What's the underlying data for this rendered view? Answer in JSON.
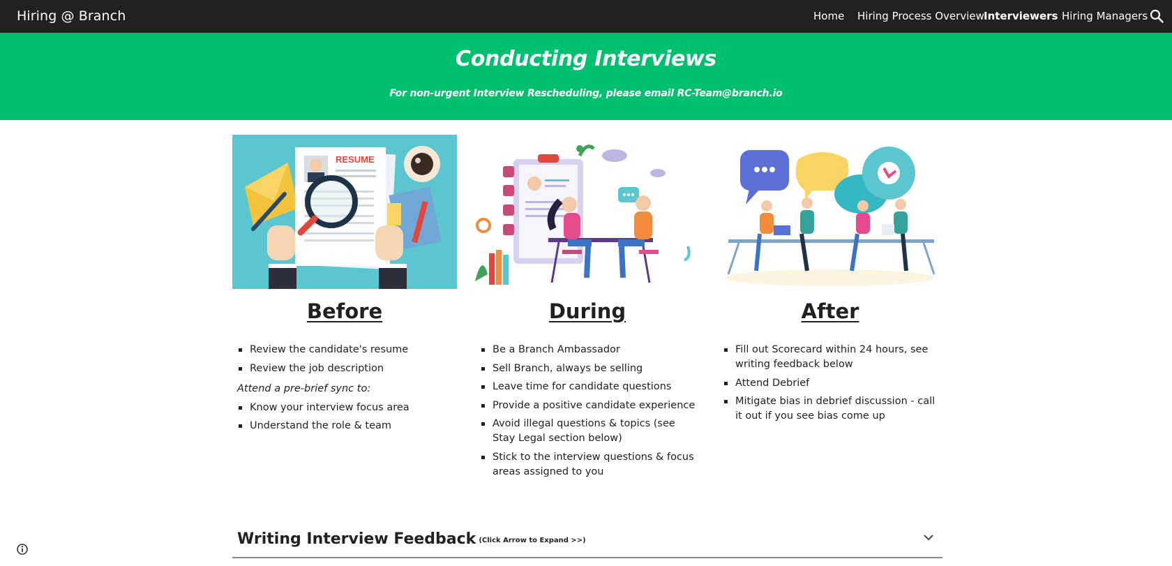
{
  "site": {
    "title": "Hiring @ Branch"
  },
  "nav": {
    "items": [
      {
        "label": "Home"
      },
      {
        "label": "Hiring Process Overview"
      },
      {
        "label": "Interviewers"
      },
      {
        "label": "Hiring Managers"
      }
    ],
    "active": "Interviewers",
    "search_icon": "search-icon"
  },
  "hero": {
    "title": "Conducting Interviews",
    "subtitle": "For non-urgent Interview Rescheduling, please email RC-Team@branch.io",
    "background": "#00bf6f"
  },
  "columns": [
    {
      "heading": "Before",
      "image": "resume-review-illustration",
      "items": [
        "Review the candidate's resume",
        "Review the job description"
      ],
      "note": "Attend a pre-brief sync to:",
      "items2": [
        "Know your interview focus area",
        "Understand the role & team"
      ]
    },
    {
      "heading": "During",
      "image": "interview-conversation-illustration",
      "items": [
        "Be a Branch Ambassador",
        "Sell Branch, always be selling",
        "Leave time for candidate questions",
        "Provide a positive candidate experience",
        "Avoid illegal questions & topics (see Stay Legal section below)",
        "Stick to the interview questions & focus areas assigned to you"
      ]
    },
    {
      "heading": "After",
      "image": "team-debrief-illustration",
      "items": [
        "Fill out Scorecard within 24 hours, see writing feedback below",
        "Attend Debrief",
        "Mitigate bias in debrief discussion - call it out if you see bias come up"
      ]
    }
  ],
  "section": {
    "title": "Writing Interview Feedback",
    "hint": "(Click Arrow to Expand >>)",
    "icon": "chevron-down-icon"
  },
  "footer": {
    "icon": "info-icon"
  }
}
